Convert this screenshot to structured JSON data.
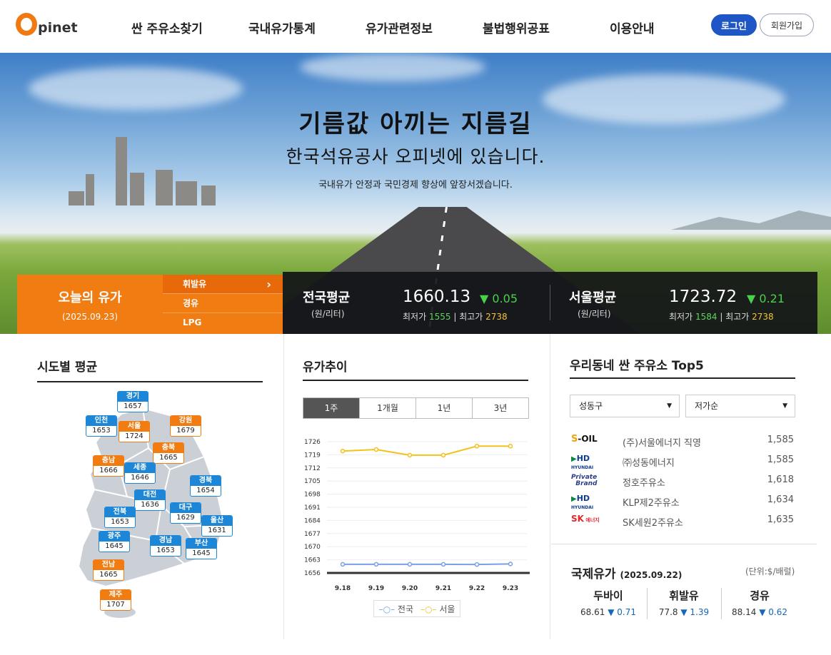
{
  "header": {
    "logo_o": "O",
    "logo_text": "pinet",
    "nav": [
      "싼 주유소찾기",
      "국내유가통계",
      "유가관련정보",
      "불법행위공표",
      "이용안내"
    ],
    "login_label": "로그인",
    "join_label": "회원가입"
  },
  "hero": {
    "title": "기름값 아끼는 지름길",
    "subtitle": "한국석유공사 오피넷에 있습니다.",
    "desc": "국내유가 안정과 국민경제 향상에 앞장서겠습니다."
  },
  "today": {
    "title": "오늘의 유가",
    "date": "(2025.09.23)",
    "fuel_tabs": [
      "휘발유",
      "경유",
      "LPG"
    ],
    "active_tab": "휘발유",
    "national": {
      "label": "전국평균",
      "unit": "(원/리터)",
      "value": "1660.13",
      "change": "▼ 0.05",
      "min_label": "최저가",
      "min": "1555",
      "max_label": "최고가",
      "max": "2738"
    },
    "seoul": {
      "label": "서울평균",
      "unit": "(원/리터)",
      "value": "1723.72",
      "change": "▼ 0.21",
      "min_label": "최저가",
      "min": "1584",
      "max_label": "최고가",
      "max": "2738"
    }
  },
  "regional": {
    "title": "시도별 평균",
    "regions": [
      {
        "name": "경기",
        "price": "1657",
        "color": "blue"
      },
      {
        "name": "인천",
        "price": "1653",
        "color": "blue"
      },
      {
        "name": "서울",
        "price": "1724",
        "color": "orange"
      },
      {
        "name": "강원",
        "price": "1679",
        "color": "orange"
      },
      {
        "name": "충북",
        "price": "1665",
        "color": "orange"
      },
      {
        "name": "충남",
        "price": "1666",
        "color": "orange"
      },
      {
        "name": "세종",
        "price": "1646",
        "color": "blue"
      },
      {
        "name": "경북",
        "price": "1654",
        "color": "blue"
      },
      {
        "name": "대전",
        "price": "1636",
        "color": "blue"
      },
      {
        "name": "전북",
        "price": "1653",
        "color": "blue"
      },
      {
        "name": "대구",
        "price": "1629",
        "color": "blue"
      },
      {
        "name": "울산",
        "price": "1631",
        "color": "blue"
      },
      {
        "name": "광주",
        "price": "1645",
        "color": "blue"
      },
      {
        "name": "경남",
        "price": "1653",
        "color": "blue"
      },
      {
        "name": "부산",
        "price": "1645",
        "color": "blue"
      },
      {
        "name": "전남",
        "price": "1665",
        "color": "orange"
      },
      {
        "name": "제주",
        "price": "1707",
        "color": "orange"
      }
    ]
  },
  "trend": {
    "title": "유가추이",
    "tabs": [
      "1주",
      "1개월",
      "1년",
      "3년"
    ],
    "active_tab": "1주",
    "legend": [
      "전국",
      "서울"
    ]
  },
  "chart_data": {
    "type": "line",
    "categories": [
      "9.18",
      "9.19",
      "9.20",
      "9.21",
      "9.22",
      "9.23"
    ],
    "series": [
      {
        "name": "전국",
        "color": "#7aa0e6",
        "values": [
          1660.6,
          1660.6,
          1660.6,
          1660.6,
          1660.5,
          1660.8
        ]
      },
      {
        "name": "서울",
        "color": "#f2c21b",
        "values": [
          1721.0,
          1721.8,
          1718.8,
          1718.8,
          1723.6,
          1723.6
        ]
      }
    ],
    "yticks": [
      1656,
      1663,
      1670,
      1677,
      1684,
      1691,
      1698,
      1705,
      1712,
      1719,
      1726
    ],
    "ylim": [
      1656,
      1726
    ]
  },
  "top5": {
    "title": "우리동네 싼 주유소 Top5",
    "district": "성동구",
    "sort": "저가순",
    "stations": [
      {
        "brand": "S-OIL",
        "name": "(주)서울에너지 직영",
        "price": "1,585"
      },
      {
        "brand": "HD",
        "name": "㈜성동에너지",
        "price": "1,585"
      },
      {
        "brand": "Private Brand",
        "name": "정호주유소",
        "price": "1,618"
      },
      {
        "brand": "HD",
        "name": "KLP제2주유소",
        "price": "1,634"
      },
      {
        "brand": "SK",
        "name": "SK세원2주유소",
        "price": "1,635"
      }
    ]
  },
  "intl": {
    "title": "국제유가",
    "date": "(2025.09.22)",
    "unit": "(단위:$/배럴)",
    "items": [
      {
        "name": "두바이",
        "value": "68.61",
        "change": "▼ 0.71"
      },
      {
        "name": "휘발유",
        "value": "77.8",
        "change": "▼ 1.39"
      },
      {
        "name": "경유",
        "value": "88.14",
        "change": "▼ 0.62"
      }
    ]
  }
}
